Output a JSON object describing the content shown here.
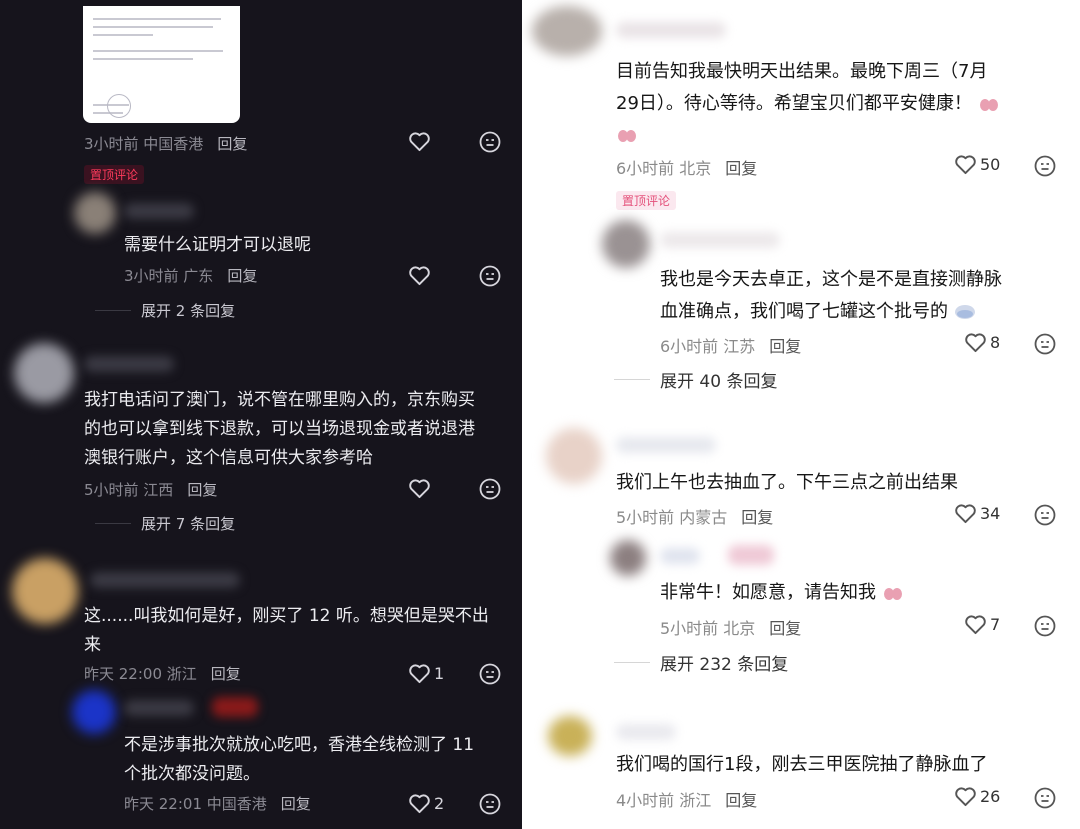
{
  "left": {
    "top_comment": {
      "meta_time": "3小时前 中国香港",
      "reply": "回复"
    },
    "pinned_label": "置顶评论",
    "c1": {
      "text": "需要什么证明才可以退呢",
      "meta_time": "3小时前 广东",
      "reply": "回复",
      "expand": "展开 2 条回复"
    },
    "c2": {
      "lines": [
        "我打电话问了澳门，说不管在哪里购入的，京东购买",
        "的也可以拿到线下退款，可以当场退现金或者说退港",
        "澳银行账户，这个信息可供大家参考哈"
      ],
      "meta_time": "5小时前 江西",
      "reply": "回复",
      "expand": "展开 7 条回复"
    },
    "c3": {
      "lines": [
        "这......叫我如何是好，刚买了 12 听。想哭但是哭不出",
        "来"
      ],
      "meta_time": "昨天 22:00 浙江",
      "reply": "回复",
      "likes": "1"
    },
    "c4": {
      "lines": [
        "不是涉事批次就放心吃吧，香港全线检测了 11",
        "个批次都没问题。"
      ],
      "meta_time": "昨天 22:01 中国香港",
      "reply": "回复",
      "likes": "2"
    }
  },
  "right": {
    "c1": {
      "lines": [
        "目前告知我最快明天出结果。最晚下周三（7月",
        "29日）。待心等待。希望宝贝们都平安健康！"
      ],
      "meta_time": "6小时前 北京",
      "reply": "回复",
      "likes": "50"
    },
    "pinned_label": "置顶评论",
    "c2": {
      "lines": [
        "我也是今天去卓正，这个是不是直接测静脉",
        "血准确点，我们喝了七罐这个批号的"
      ],
      "meta_time": "6小时前 江苏",
      "reply": "回复",
      "likes": "8",
      "expand": "展开 40 条回复"
    },
    "c3": {
      "text": "我们上午也去抽血了。下午三点之前出结果",
      "meta_time": "5小时前 内蒙古",
      "reply": "回复",
      "likes": "34"
    },
    "c4": {
      "text": "非常牛！如愿意，请告知我",
      "meta_time": "5小时前 北京",
      "reply": "回复",
      "likes": "7",
      "expand": "展开 232 条回复"
    },
    "c5": {
      "text": "我们喝的国行1段，刚去三甲医院抽了静脉血了",
      "meta_time": "4小时前 浙江",
      "reply": "回复",
      "likes": "26"
    }
  }
}
